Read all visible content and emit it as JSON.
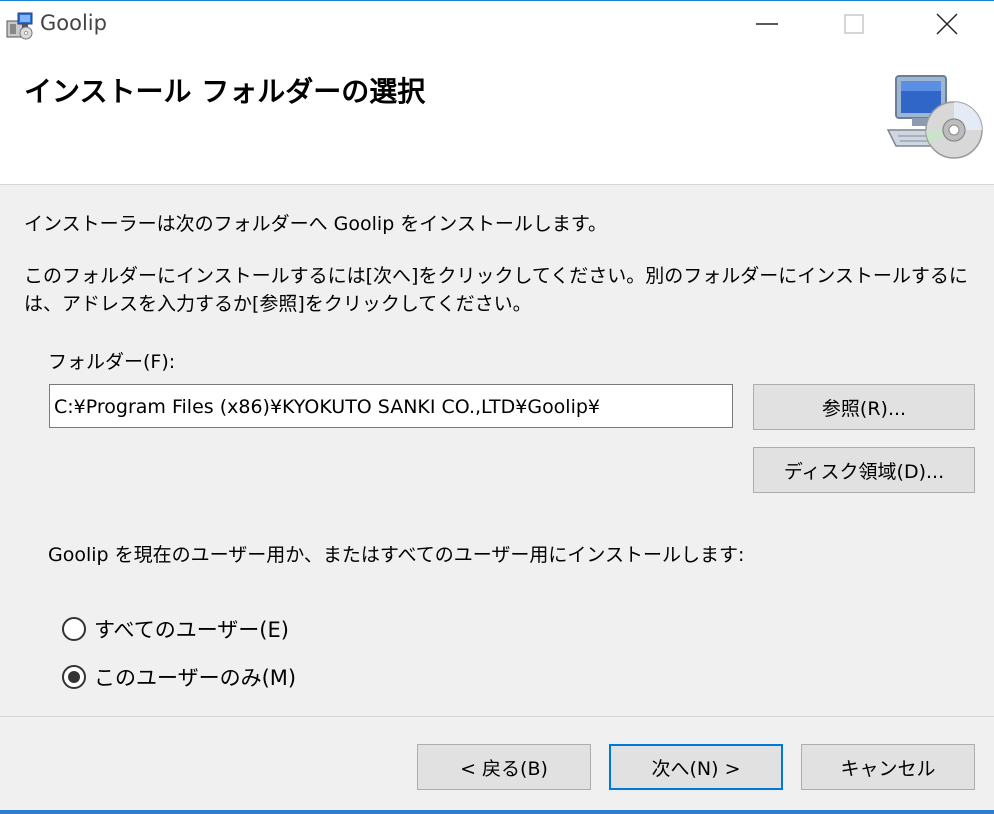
{
  "window": {
    "title": "Goolip"
  },
  "header": {
    "title": "インストール フォルダーの選択"
  },
  "body": {
    "intro": "インストーラーは次のフォルダーへ Goolip をインストールします。",
    "instruction": "このフォルダーにインストールするには[次へ]をクリックしてください。別のフォルダーにインストールするには、アドレスを入力するか[参照]をクリックしてください。",
    "folder_label": "フォルダー(F):",
    "folder_value": "C:¥Program Files (x86)¥KYOKUTO SANKI CO.,LTD¥Goolip¥",
    "browse_label": "参照(R)...",
    "disk_label": "ディスク領域(D)...",
    "scope_text": "Goolip を現在のユーザー用か、またはすべてのユーザー用にインストールします:",
    "radio_all_label": "すべてのユーザー(E)",
    "radio_me_label": "このユーザーのみ(M)",
    "selected_scope": "このユーザーのみ(M)"
  },
  "footer": {
    "back_label": "< 戻る(B)",
    "next_label": "次へ(N) >",
    "cancel_label": "キャンセル"
  },
  "colors": {
    "accent": "#0078d7",
    "window_border": "#1883d7",
    "button_face": "#e1e1e1",
    "dialog_bg": "#f0f0f0"
  },
  "icons": {
    "app": "installer-package-icon",
    "header": "computer-cd-icon",
    "minimize": "minimize-icon",
    "maximize": "maximize-icon",
    "close": "close-icon"
  }
}
